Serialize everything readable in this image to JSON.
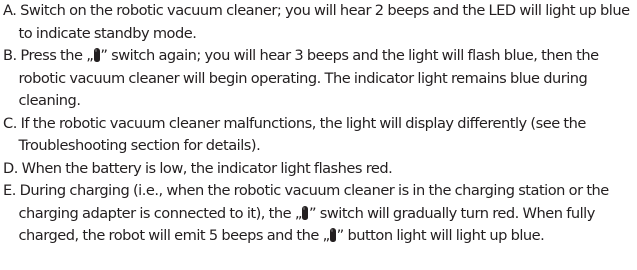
{
  "instructions": {
    "items": [
      {
        "marker": "A.",
        "text": "Switch on the robotic vacuum cleaner; you will hear 2 beeps and the LED will light up blue to indicate standby mode."
      },
      {
        "marker": "B.",
        "text_before": "Press the „",
        "text_after": "” switch again; you will hear 3 beeps and the light will flash blue, then the robotic vacuum cleaner will begin operating. The indicator light remains blue during cleaning."
      },
      {
        "marker": "C.",
        "text": "If the robotic vacuum cleaner malfunctions, the light will display differently (see the Troubleshooting section for details)."
      },
      {
        "marker": "D.",
        "text": "When the battery is low, the indicator light flashes red."
      },
      {
        "marker": "E.",
        "text_before": "During charging (i.e., when the robotic vacuum cleaner is in the charging station or the charging adapter is connected to it), the „",
        "text_middle": "” switch will gradually turn red. When fully charged, the robot will emit 5 beeps and the „",
        "text_after": "” button light will light up blue."
      }
    ],
    "icon": "power-switch-icon",
    "text_color": "#231f20"
  }
}
